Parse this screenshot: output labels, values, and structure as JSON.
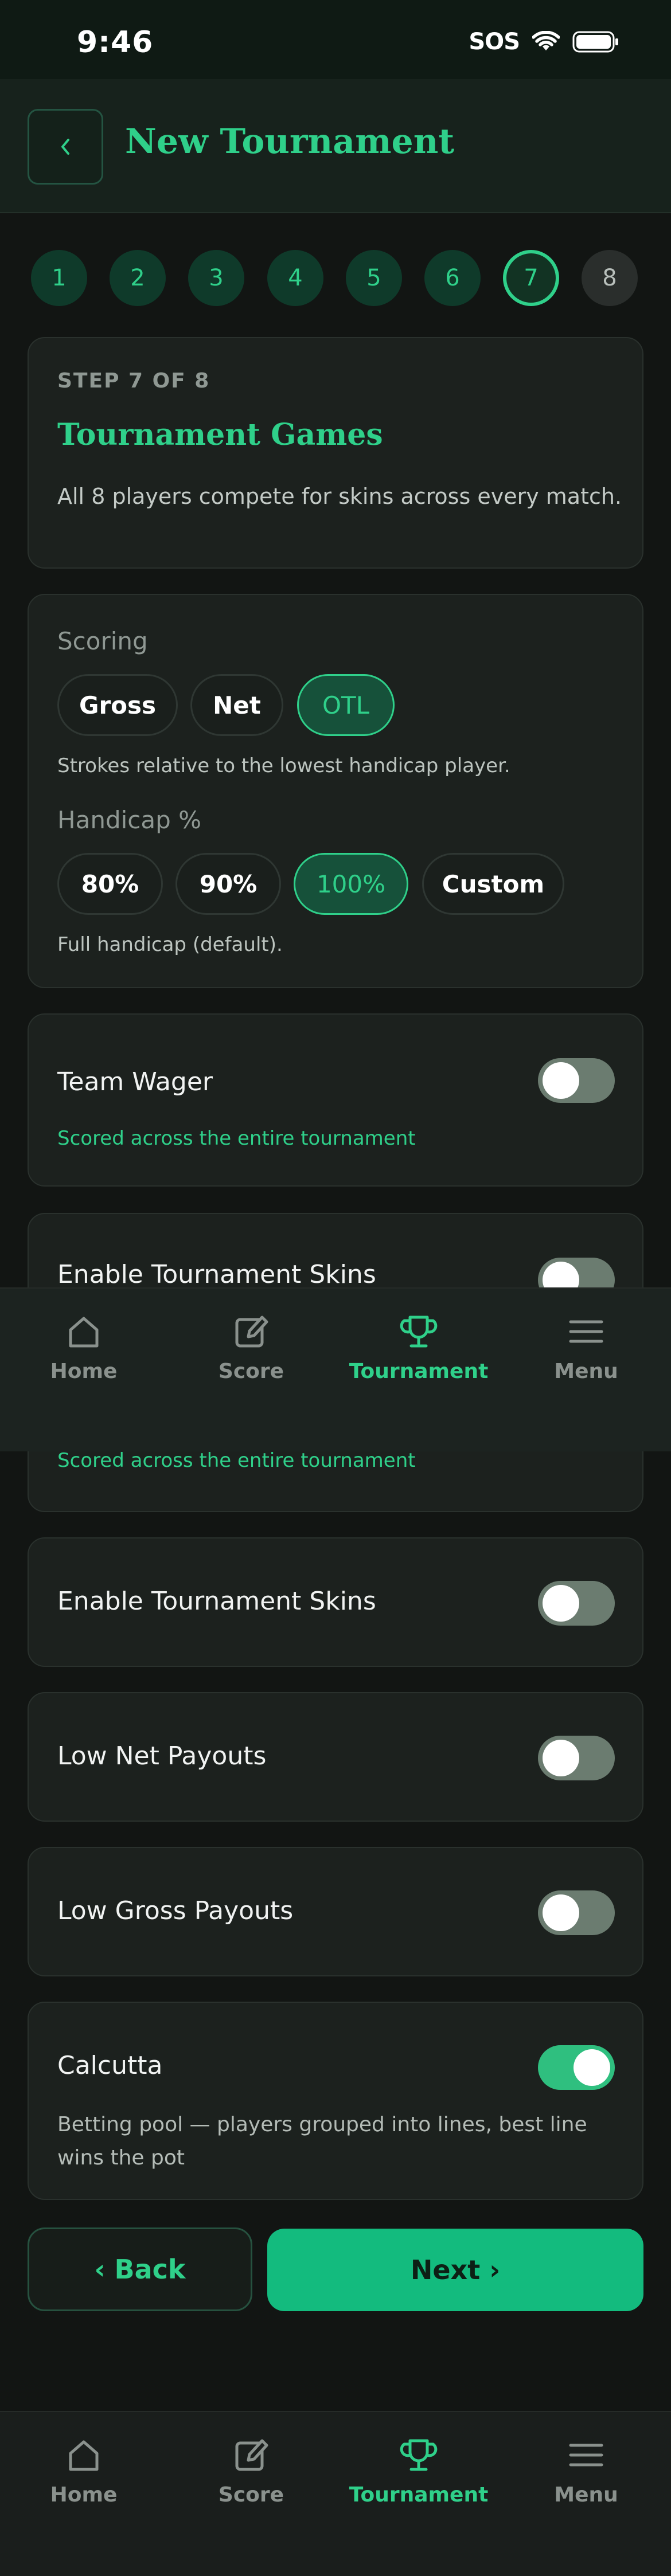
{
  "status_bar": {
    "time": "9:46",
    "sos": "SOS"
  },
  "header": {
    "title": "New Tournament"
  },
  "steps": [
    "1",
    "2",
    "3",
    "4",
    "5",
    "6",
    "7",
    "8"
  ],
  "step_card": {
    "eyebrow": "STEP 7 OF 8",
    "title": "Tournament Games",
    "description": "All 8 players compete for skins across every match."
  },
  "scoring": {
    "label": "Scoring",
    "options": [
      "Gross",
      "Net",
      "OTL"
    ],
    "selected": "OTL",
    "hint": "Strokes relative to the lowest handicap player."
  },
  "handicap": {
    "label": "Handicap %",
    "options": [
      "80%",
      "90%",
      "100%",
      "Custom"
    ],
    "selected": "100%",
    "hint": "Full handicap (default)."
  },
  "team_wager": {
    "label": "Team Wager",
    "sub": "Scored across the entire tournament",
    "on": false
  },
  "overlay_fragment": {
    "label": "Enable Tournament Skins",
    "sub": "Scored across the entire tournament"
  },
  "tournament_skins": {
    "label": "Enable Tournament Skins",
    "on": false
  },
  "low_net": {
    "label": "Low Net Payouts",
    "on": false
  },
  "low_gross": {
    "label": "Low Gross Payouts",
    "on": false
  },
  "calcutta": {
    "label": "Calcutta",
    "sub": "Betting pool — players grouped into lines, best line wins the pot",
    "on": true
  },
  "actions": {
    "back": "‹ Back",
    "next": "Next ›"
  },
  "tabs": [
    {
      "label": "Home",
      "icon": "home-icon"
    },
    {
      "label": "Score",
      "icon": "edit-icon"
    },
    {
      "label": "Tournament",
      "icon": "trophy-icon"
    },
    {
      "label": "Menu",
      "icon": "menu-icon"
    }
  ],
  "active_tab": "Tournament",
  "colors": {
    "accent": "#2fd08a",
    "background": "#121513",
    "card": "#1c211e",
    "button": "#13bb7e"
  }
}
